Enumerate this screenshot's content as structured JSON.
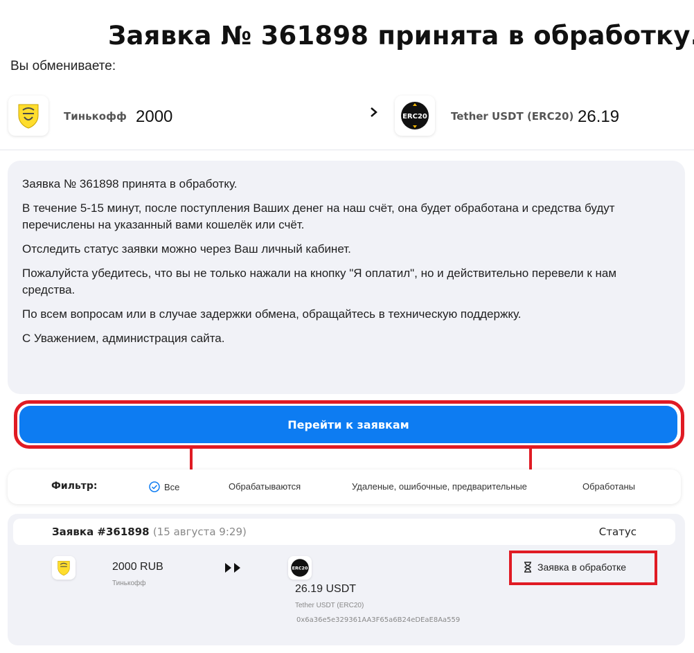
{
  "page": {
    "title": "Заявка № 361898 принята в обработку.",
    "you_exchange_label": "Вы обмениваете:"
  },
  "exchange": {
    "from": {
      "name": "Тинькофф",
      "amount": "2000",
      "icon": "tinkoff-logo"
    },
    "to": {
      "name": "Tether USDT (ERC20)",
      "amount": "26.19",
      "icon": "erc20-logo",
      "logo_text": "ERC20"
    },
    "arrow_icon": "chevron-right-icon"
  },
  "info": {
    "paragraphs": [
      "Заявка № 361898 принята в обработку.",
      "В течение 5-15 минут, после поступления Ваших денег на наш счёт, она будет обработана и средства будут перечислены на указанный вами кошелёк или счёт.",
      "Отследить статус заявки можно через Ваш личный кабинет.",
      "Пожалуйста убедитесь, что вы не только нажали на кнопку \"Я оплатил\", но и действительно перевели к нам средства.",
      "По всем вопросам или в случае задержки обмена, обращайтесь в техническую поддержку.",
      "С Уважением, администрация сайта."
    ]
  },
  "actions": {
    "go_to_orders": "Перейти к заявкам"
  },
  "filter": {
    "label": "Фильтр:",
    "options": [
      "Все",
      "Обрабатываются",
      "Удаленые, ошибочные, предварительные",
      "Обработаны"
    ],
    "selected": "Все"
  },
  "order": {
    "title": "Заявка #361898",
    "date": "(15 августа 9:29)",
    "status_header": "Статус",
    "give": {
      "amount": "2000 RUB",
      "method": "Тинькофф"
    },
    "get": {
      "amount": "26.19 USDT",
      "method": "Tether USDT (ERC20)",
      "address": "0x6a36e5e329361AA3F65a6B24eDEaE8Aa559"
    },
    "status": "Заявка в обработке",
    "status_icon": "hourglass-icon"
  },
  "colors": {
    "accent_blue": "#0d7cf2",
    "annotation_red": "#e01b24",
    "card_bg": "#f1f2f7"
  }
}
